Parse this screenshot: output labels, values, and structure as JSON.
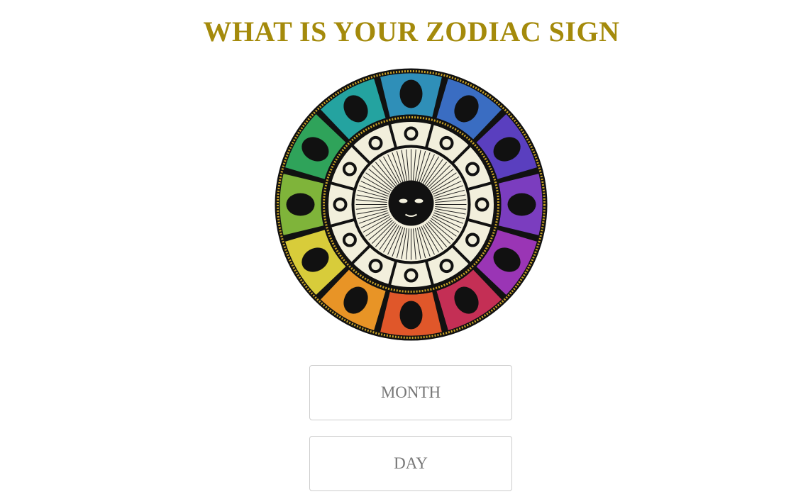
{
  "header": {
    "title": "WHAT IS YOUR ZODIAC SIGN",
    "title_color": "#a48a0b"
  },
  "wheel": {
    "image": "zodiac-wheel",
    "segment_colors": [
      "#2f8fb8",
      "#3a6dc2",
      "#5a3fbf",
      "#7b3dbf",
      "#9a35b5",
      "#c42f55",
      "#e0572a",
      "#e89426",
      "#d8cc3a",
      "#7fb43a",
      "#2fa35a",
      "#24a3a0"
    ]
  },
  "form": {
    "month": {
      "placeholder": "MONTH",
      "value": ""
    },
    "day": {
      "placeholder": "DAY",
      "value": ""
    }
  }
}
